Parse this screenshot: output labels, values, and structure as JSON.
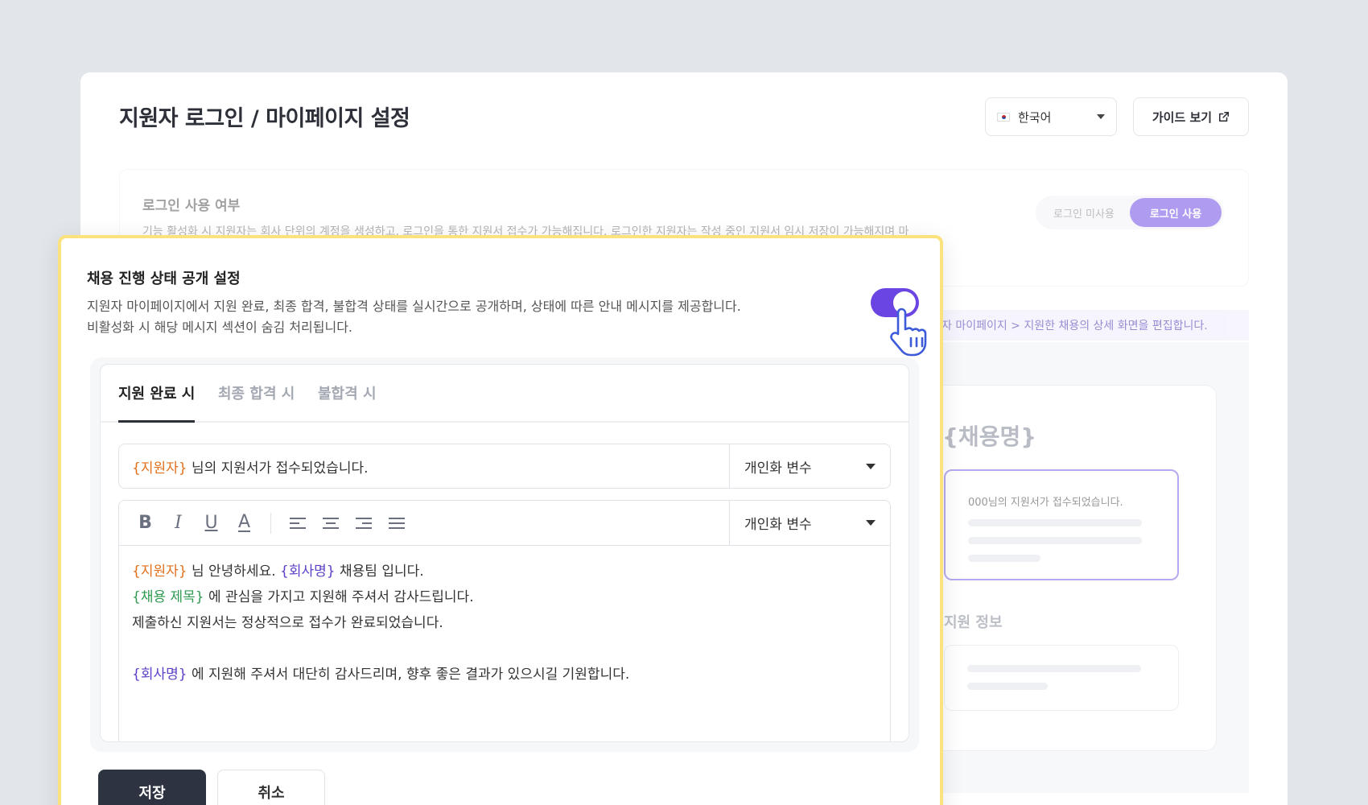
{
  "page": {
    "title": "지원자 로그인 / 마이페이지 설정",
    "language": "한국어",
    "guide_label": "가이드 보기"
  },
  "login": {
    "title": "로그인 사용 여부",
    "desc": "기능 활성화 시 지원자는 회사 단위의 계정을 생성하고, 로그인을 통한 지원서 접수가 가능해집니다. 로그인한 지원자는 작성 중인 지원서 임시 저장이 가능해지며 마",
    "option_off": "로그인 미사용",
    "option_on": "로그인 사용"
  },
  "background": {
    "banner": "자 마이페이지 > 지원한 채용의 상세 화면을 편집합니다.",
    "preview": {
      "title": "{채용명}",
      "message": "000님의 지원서가 접수되었습니다.",
      "section": "지원 정보"
    }
  },
  "status_panel": {
    "title": "채용 진행 상태 공개 설정",
    "desc_line1": "지원자 마이페이지에서 지원 완료, 최종 합격, 불합격 상태를 실시간으로 공개하며, 상태에 따른 안내 메시지를 제공합니다.",
    "desc_line2": "비활성화 시 해당 메시지 섹션이 숨김 처리됩니다.",
    "toggle_on": true,
    "tabs": [
      "지원 완료 시",
      "최종 합격 시",
      "불합격 시"
    ],
    "subject": {
      "var": "{지원자}",
      "text": " 님의 지원서가 접수되었습니다."
    },
    "var_select_label": "개인화 변수",
    "toolbar": {
      "bold": "B",
      "italic": "I",
      "underline": "U",
      "color": "A"
    },
    "body": {
      "l1_var1": "{지원자}",
      "l1_t1": " 님 안녕하세요. ",
      "l1_var2": "{회사명}",
      "l1_t2": " 채용팀 입니다.",
      "l2_var": "{채용 제목}",
      "l2_t": " 에 관심을 가지고 지원해 주셔서 감사드립니다.",
      "l3_t": "제출하신 지원서는 정상적으로 접수가 완료되었습니다.",
      "l5_var": "{회사명}",
      "l5_t": " 에 지원해 주셔서 대단히 감사드리며, 향후 좋은 결과가 있으시길 기원합니다."
    },
    "save_label": "저장",
    "cancel_label": "취소"
  },
  "colors": {
    "accent": "#6a45e3",
    "highlight_border": "#fbe27d",
    "var_orange": "#e0701c",
    "var_purple": "#5c3fc6",
    "var_green": "#2e9a52"
  }
}
